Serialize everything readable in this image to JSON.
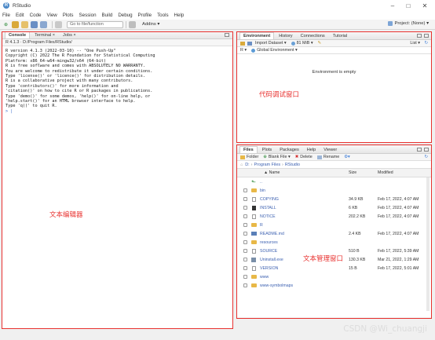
{
  "window": {
    "title": "RStudio",
    "minimize": "–",
    "maximize": "□",
    "close": "✕"
  },
  "menubar": [
    "File",
    "Edit",
    "Code",
    "View",
    "Plots",
    "Session",
    "Build",
    "Debug",
    "Profile",
    "Tools",
    "Help"
  ],
  "toolbar": {
    "goto_placeholder": "Go to file/function",
    "addins_label": "Addins ▾",
    "project_label": "Project: (None) ▾"
  },
  "console_pane": {
    "tabs": [
      "Console",
      "Terminal ×",
      "Jobs ×"
    ],
    "path": "R 4.1.3 · D:/Program Files/RStudio/",
    "lines": [
      "R version 4.1.3 (2022-03-10) -- \"One Push-Up\"",
      "Copyright (C) 2022 The R Foundation for Statistical Computing",
      "Platform: x86_64-w64-mingw32/x64 (64-bit)",
      "",
      "R is free software and comes with ABSOLUTELY NO WARRANTY.",
      "You are welcome to redistribute it under certain conditions.",
      "Type 'license()' or 'licence()' for distribution details.",
      "",
      "R is a collaborative project with many contributors.",
      "Type 'contributors()' for more information and",
      "'citation()' on how to cite R or R packages in publications.",
      "",
      "Type 'demo()' for some demos, 'help()' for on-line help, or",
      "'help.start()' for an HTML browser interface to help.",
      "Type 'q()' to quit R.",
      ""
    ],
    "prompt": "> |",
    "annotation": "文本编辑器"
  },
  "env_pane": {
    "tabs": [
      "Environment",
      "History",
      "Connections",
      "Tutorial"
    ],
    "import_dataset": "Import Dataset ▾",
    "memory": "81 MiB ▾",
    "list_label": "List ▾",
    "r_label": "R ▾",
    "global_env": "Global Environment ▾",
    "empty_message": "Environment is empty",
    "annotation": "代码调试窗口"
  },
  "files_pane": {
    "tabs": [
      "Files",
      "Plots",
      "Packages",
      "Help",
      "Viewer"
    ],
    "actions": {
      "folder": "Folder",
      "blank_file": "Blank File ▾",
      "delete": "Delete",
      "rename": "Rename"
    },
    "breadcrumb": [
      "D:",
      "Program Files",
      "RStudio"
    ],
    "columns": {
      "name": "▲ Name",
      "size": "Size",
      "modified": "Modified"
    },
    "up_label": "..",
    "rows": [
      {
        "name": "bin",
        "size": "",
        "modified": "",
        "type": "folder"
      },
      {
        "name": "COPYING",
        "size": "34.9 KB",
        "modified": "Feb 17, 2022, 4:07 AM",
        "type": "file"
      },
      {
        "name": "INSTALL",
        "size": "6 KB",
        "modified": "Feb 17, 2022, 4:07 AM",
        "type": "file"
      },
      {
        "name": "NOTICE",
        "size": "202.2 KB",
        "modified": "Feb 17, 2022, 4:07 AM",
        "type": "file"
      },
      {
        "name": "R",
        "size": "",
        "modified": "",
        "type": "folder"
      },
      {
        "name": "README.md",
        "size": "2.4 KB",
        "modified": "Feb 17, 2022, 4:07 AM",
        "type": "md"
      },
      {
        "name": "resources",
        "size": "",
        "modified": "",
        "type": "folder"
      },
      {
        "name": "SOURCE",
        "size": "510 B",
        "modified": "Feb 17, 2022, 5:39 AM",
        "type": "file"
      },
      {
        "name": "Uninstall.exe",
        "size": "130.3 KB",
        "modified": "Mar 21, 2022, 1:29 AM",
        "type": "exe"
      },
      {
        "name": "VERSION",
        "size": "15 B",
        "modified": "Feb 17, 2022, 5:01 AM",
        "type": "file"
      },
      {
        "name": "www",
        "size": "",
        "modified": "",
        "type": "folder"
      },
      {
        "name": "www-symbolmaps",
        "size": "",
        "modified": "",
        "type": "folder"
      }
    ],
    "annotation": "文本管理窗口"
  },
  "watermark": "CSDN @Wi_chuangji",
  "colors": {
    "annotation_red": "#e8312f",
    "file_link": "#3a5fb0",
    "folder": "#e8b847"
  }
}
